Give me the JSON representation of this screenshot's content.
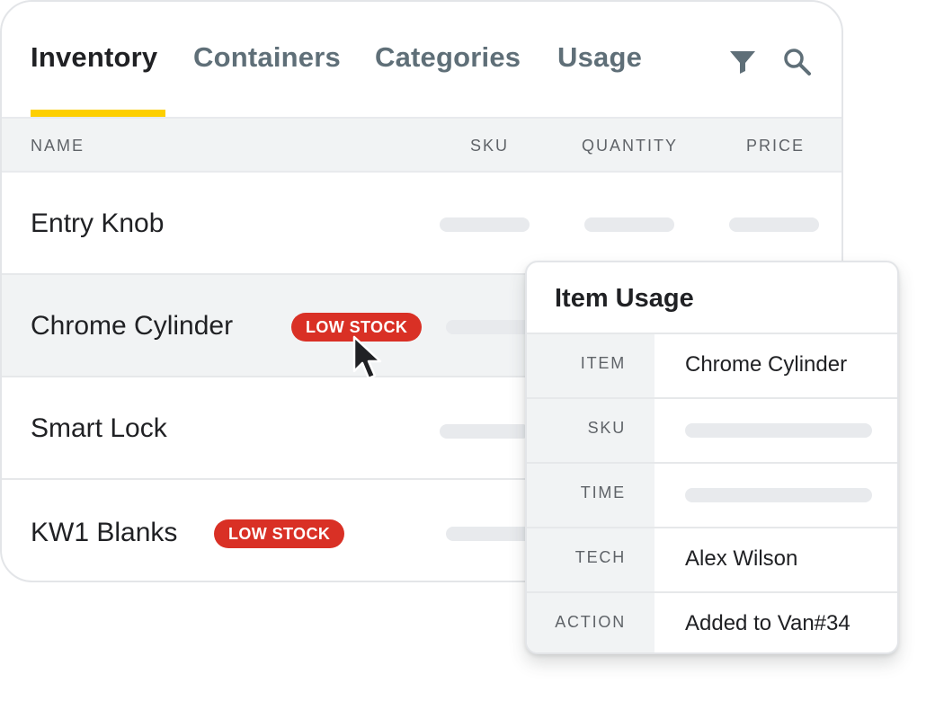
{
  "tabs": [
    {
      "label": "Inventory",
      "active": true
    },
    {
      "label": "Containers",
      "active": false
    },
    {
      "label": "Categories",
      "active": false
    },
    {
      "label": "Usage",
      "active": false
    }
  ],
  "toolbar": {
    "filter_icon": "filter-icon",
    "search_icon": "search-icon"
  },
  "columns": {
    "name": "NAME",
    "sku": "SKU",
    "quantity": "QUANTITY",
    "price": "PRICE"
  },
  "rows": [
    {
      "name": "Entry Knob",
      "badge": ""
    },
    {
      "name": "Chrome Cylinder",
      "badge": "LOW STOCK"
    },
    {
      "name": "Smart Lock",
      "badge": ""
    },
    {
      "name": "KW1 Blanks",
      "badge": "LOW STOCK"
    }
  ],
  "popup": {
    "title": "Item Usage",
    "fields": [
      {
        "label": "ITEM",
        "value": "Chrome Cylinder"
      },
      {
        "label": "SKU",
        "value": ""
      },
      {
        "label": "TIME",
        "value": ""
      },
      {
        "label": "TECH",
        "value": "Alex Wilson"
      },
      {
        "label": "ACTION",
        "value": "Added to Van#34"
      }
    ]
  },
  "colors": {
    "accent_underline": "#fdcf00",
    "badge_red": "#d93025",
    "text_primary": "#202124",
    "text_muted": "#5f6f78"
  }
}
